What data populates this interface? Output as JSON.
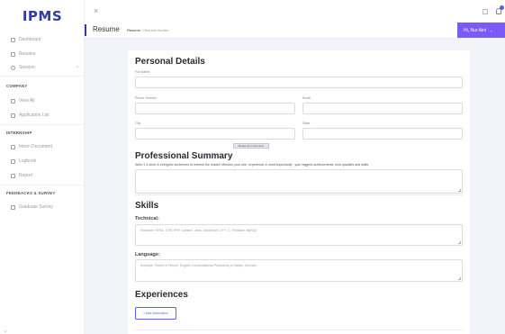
{
  "app": {
    "logo": "IPMS"
  },
  "sidebar": {
    "items": [
      {
        "label": "Dashboard",
        "icon": "dashboard-icon"
      },
      {
        "label": "Resume",
        "icon": "document-icon"
      },
      {
        "label": "Session",
        "icon": "user-icon",
        "caret": "⌄"
      }
    ],
    "sections": [
      {
        "title": "COMPANY",
        "items": [
          {
            "label": "View All"
          },
          {
            "label": "Application List"
          }
        ]
      },
      {
        "title": "INTERNSHIP",
        "items": [
          {
            "label": "Intern Document"
          },
          {
            "label": "Logbook"
          },
          {
            "label": "Report"
          }
        ]
      },
      {
        "title": "FEEDBACKS & SURVEY",
        "items": [
          {
            "label": "Graduate Survey"
          }
        ]
      }
    ]
  },
  "topbar": {
    "close_glyph": "×"
  },
  "header": {
    "title": "Resume",
    "breadcrumb": {
      "root": "Resume",
      "sep": "/",
      "current": "Resume Builder"
    },
    "user_label": "Hi, Nur Aini",
    "user_caret": "⌄"
  },
  "personal": {
    "heading": "Personal Details",
    "full_name_label": "Full Name",
    "phone_label": "Phone Number",
    "email_label": "Email",
    "city_label": "City",
    "state_label": "State",
    "tooltip": "Please fill in this field."
  },
  "summary": {
    "heading": "Professional Summary",
    "description": "Write 2-4 short & energetic sentences to interest the reader! Mention your role, experience & most importantly - your biggest achievements, best qualities and skills."
  },
  "skills": {
    "heading": "Skills",
    "technical_label": "Technical:",
    "technical_placeholder": "Example: HTML, CSS, PHP, Laravel, Java, JavaScript, C++, C, Firebase, MySQL",
    "language_label": "Language:",
    "language_placeholder": "Example: Fluent in French, English Conversational Proficiency in Italian, German"
  },
  "experiences": {
    "heading": "Experiences",
    "add_button": "+ Add information"
  },
  "footer": {
    "mark": "A"
  },
  "colors": {
    "brand": "#2f3da0",
    "accent": "#7a5af8",
    "link": "#5b5fe6"
  }
}
